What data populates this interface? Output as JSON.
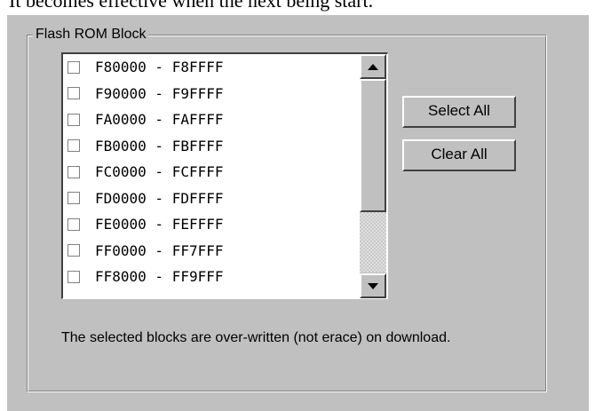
{
  "document": {
    "caption_text": "It becomes effective when the next being start."
  },
  "group": {
    "title": "Flash ROM Block"
  },
  "list": {
    "items": [
      {
        "label": "F80000 - F8FFFF",
        "checked": false
      },
      {
        "label": "F90000 - F9FFFF",
        "checked": false
      },
      {
        "label": "FA0000 - FAFFFF",
        "checked": false
      },
      {
        "label": "FB0000 - FBFFFF",
        "checked": false
      },
      {
        "label": "FC0000 - FCFFFF",
        "checked": false
      },
      {
        "label": "FD0000 - FDFFFF",
        "checked": false
      },
      {
        "label": "FE0000 - FEFFFF",
        "checked": false
      },
      {
        "label": "FF0000 - FF7FFF",
        "checked": false
      },
      {
        "label": "FF8000 - FF9FFF",
        "checked": false
      }
    ]
  },
  "buttons": {
    "select_all": "Select All",
    "clear_all": "Clear All"
  },
  "note": {
    "text": "The selected blocks are over-written (not erace) on download."
  },
  "colors": {
    "dialog_bg": "#c0c0c0",
    "list_bg": "#ffffff",
    "text": "#000000"
  },
  "icons": {
    "scroll_up": "triangle-up",
    "scroll_down": "triangle-down",
    "checkbox": "empty-checkbox"
  }
}
